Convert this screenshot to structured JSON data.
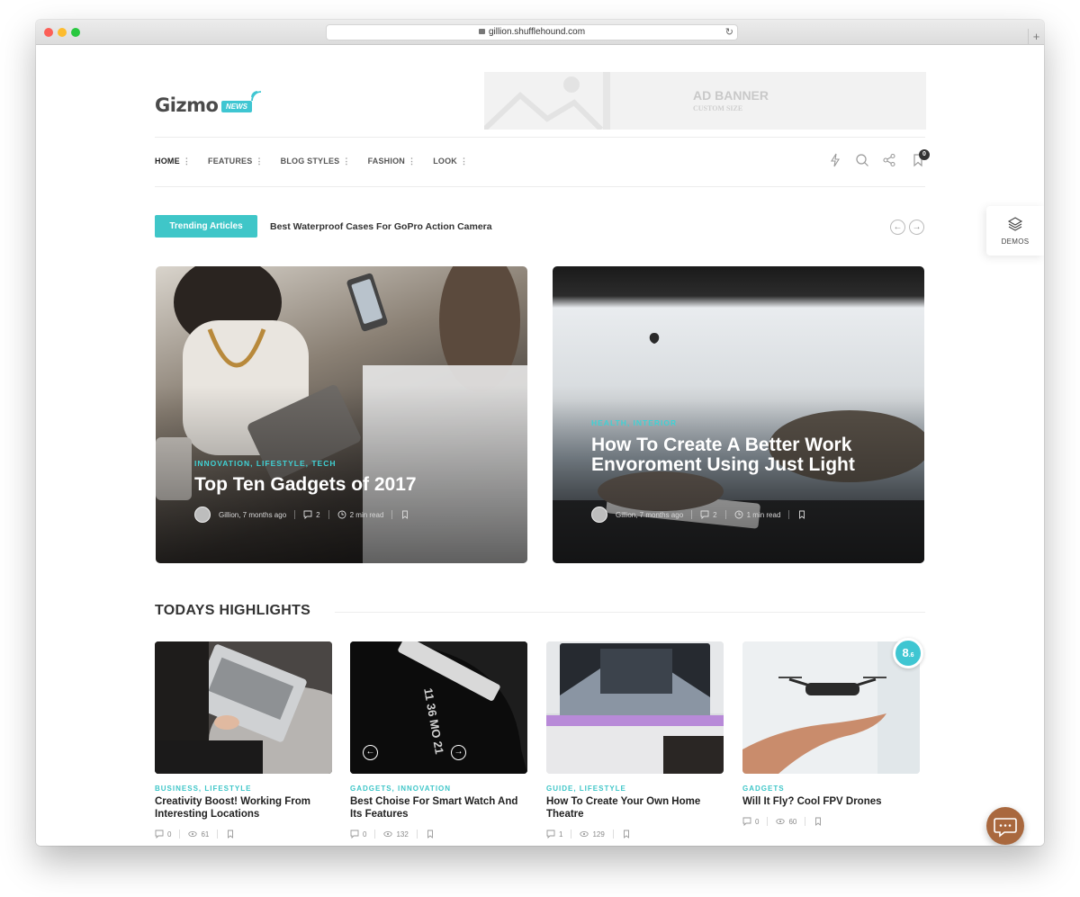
{
  "browser": {
    "url": "gillion.shufflehound.com"
  },
  "logo": {
    "name": "Gizmo",
    "badge": "NEWS"
  },
  "ad_banner": {
    "title": "AD BANNER",
    "subtitle": "CUSTOM SIZE"
  },
  "nav": {
    "items": [
      {
        "label": "HOME"
      },
      {
        "label": "FEATURES"
      },
      {
        "label": "BLOG STYLES"
      },
      {
        "label": "FASHION"
      },
      {
        "label": "LOOK"
      }
    ],
    "bookmark_count": "0"
  },
  "trending": {
    "button_label": "Trending Articles",
    "headline": "Best Waterproof Cases For GoPro Action Camera"
  },
  "demos": {
    "label": "DEMOS"
  },
  "hero_posts": [
    {
      "categories": "INNOVATION, LIFESTYLE, TECH",
      "title": "Top Ten Gadgets of 2017",
      "author": "Gillion, 7 months ago",
      "comments": "2",
      "read_time": "2 min read"
    },
    {
      "categories": "HEALTH, INTERIOR",
      "title": "How To Create A Better Work Envoroment Using Just Light",
      "author": "Gillion, 7 months ago",
      "comments": "2",
      "read_time": "1 min read"
    }
  ],
  "highlights": {
    "title": "TODAYS HIGHLIGHTS",
    "posts": [
      {
        "categories": "BUSINESS, LIFESTYLE",
        "title": "Creativity Boost! Working From Interesting Locations",
        "comments": "0",
        "views": "61"
      },
      {
        "categories": "GADGETS, INNOVATION",
        "title": "Best Choise For Smart Watch And Its Features",
        "comments": "0",
        "views": "132"
      },
      {
        "categories": "GUIDE, LIFESTYLE",
        "title": "How To Create Your Own Home Theatre",
        "comments": "1",
        "views": "129"
      },
      {
        "categories": "GADGETS",
        "title": "Will It Fly? Cool FPV Drones",
        "comments": "0",
        "views": "60"
      }
    ],
    "review_score": "8",
    "review_score_decimal": ".6"
  },
  "colors": {
    "accent": "#3fc6c8",
    "chat_button": "#a9683e"
  }
}
